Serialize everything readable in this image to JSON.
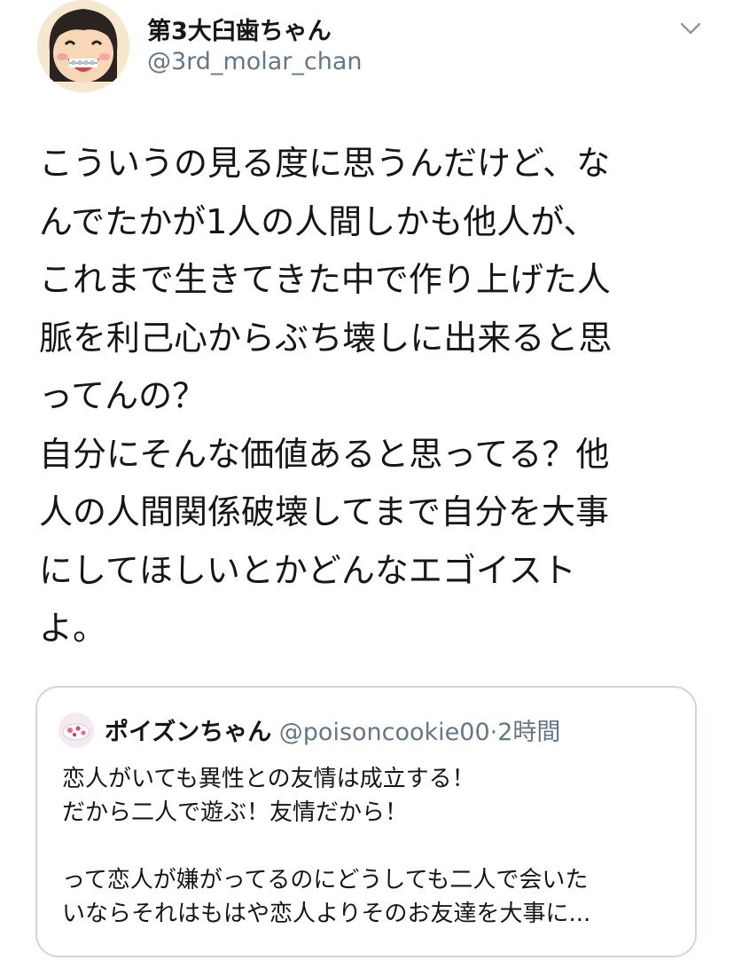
{
  "author": {
    "display_name": "第3大臼歯ちゃん",
    "handle": "@3rd_molar_chan",
    "avatar_icon": "girl-with-braces-avatar-icon"
  },
  "menu_icon": "chevron-down-icon",
  "tweet": {
    "lines": [
      "こういうの見る度に思うんだけど、な",
      "んでたかが1人の人間しかも他人が、",
      "これまで生きてきた中で作り上げた人",
      "脈を利己心からぶち壊しに出来ると思",
      "ってんの？",
      "自分にそんな価値あると思ってる？他",
      "人の人間関係破壊してまで自分を大事",
      "にしてほしいとかどんなエゴイスト",
      "よ。"
    ]
  },
  "quoted_tweet": {
    "display_name": "ポイズンちゃん",
    "handle": "@poisoncookie00",
    "separator": "·",
    "time": "2時間",
    "lines": [
      "恋人がいても異性との友情は成立する！",
      "だから二人で遊ぶ！友情だから！",
      "",
      "って恋人が嫌がってるのにどうしても二人で会いた",
      "いならそれはもはや恋人よりそのお友達を大事に..."
    ]
  },
  "colors": {
    "text": "#14171a",
    "secondary": "#657786",
    "border": "#ccd6dd"
  }
}
